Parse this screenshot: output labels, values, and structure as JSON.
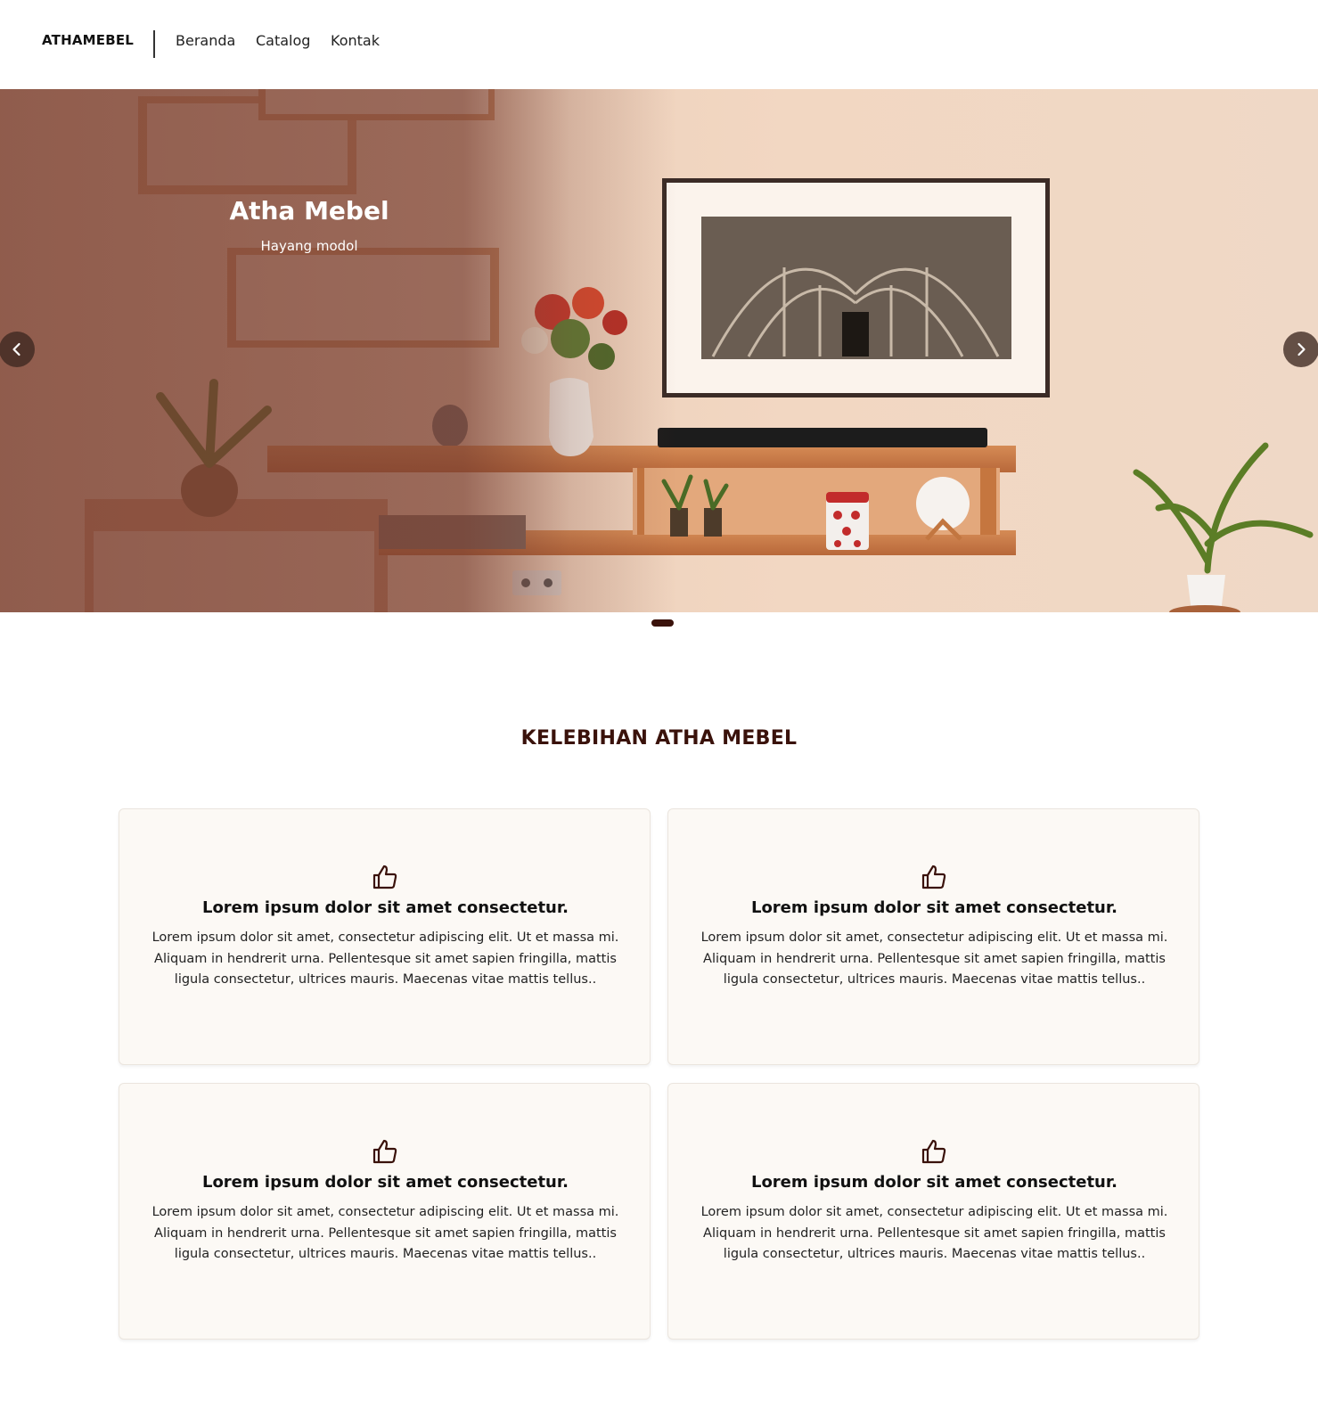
{
  "navbar": {
    "brand": "ATHAMEBEL",
    "links": [
      {
        "label": "Beranda"
      },
      {
        "label": "Catalog"
      },
      {
        "label": "Kontak"
      }
    ]
  },
  "hero": {
    "title": "Atha Mebel",
    "subtitle": "Hayang modol",
    "prev_icon": "chevron-left-icon",
    "next_icon": "chevron-right-icon",
    "active_slide": 1,
    "slide_count": 1,
    "overlay_color": "#783e30"
  },
  "features": {
    "title": "KELEBIHAN ATHA MEBEL",
    "cards": [
      {
        "icon": "thumbs-up-icon",
        "title": "Lorem ipsum dolor sit amet consectetur.",
        "text": "Lorem ipsum dolor sit amet, consectetur adipiscing elit. Ut et massa mi. Aliquam in hendrerit urna. Pellentesque sit amet sapien fringilla, mattis ligula consectetur, ultrices mauris. Maecenas vitae mattis tellus.."
      },
      {
        "icon": "thumbs-up-icon",
        "title": "Lorem ipsum dolor sit amet consectetur.",
        "text": "Lorem ipsum dolor sit amet, consectetur adipiscing elit. Ut et massa mi. Aliquam in hendrerit urna. Pellentesque sit amet sapien fringilla, mattis ligula consectetur, ultrices mauris. Maecenas vitae mattis tellus.."
      },
      {
        "icon": "thumbs-up-icon",
        "title": "Lorem ipsum dolor sit amet consectetur.",
        "text": "Lorem ipsum dolor sit amet, consectetur adipiscing elit. Ut et massa mi. Aliquam in hendrerit urna. Pellentesque sit amet sapien fringilla, mattis ligula consectetur, ultrices mauris. Maecenas vitae mattis tellus.."
      },
      {
        "icon": "thumbs-up-icon",
        "title": "Lorem ipsum dolor sit amet consectetur.",
        "text": "Lorem ipsum dolor sit amet, consectetur adipiscing elit. Ut et massa mi. Aliquam in hendrerit urna. Pellentesque sit amet sapien fringilla, mattis ligula consectetur, ultrices mauris. Maecenas vitae mattis tellus.."
      }
    ]
  },
  "colors": {
    "accent": "#3a120b",
    "card_background": "#fcf9f5",
    "hero_wall": "#e9cdb6"
  }
}
